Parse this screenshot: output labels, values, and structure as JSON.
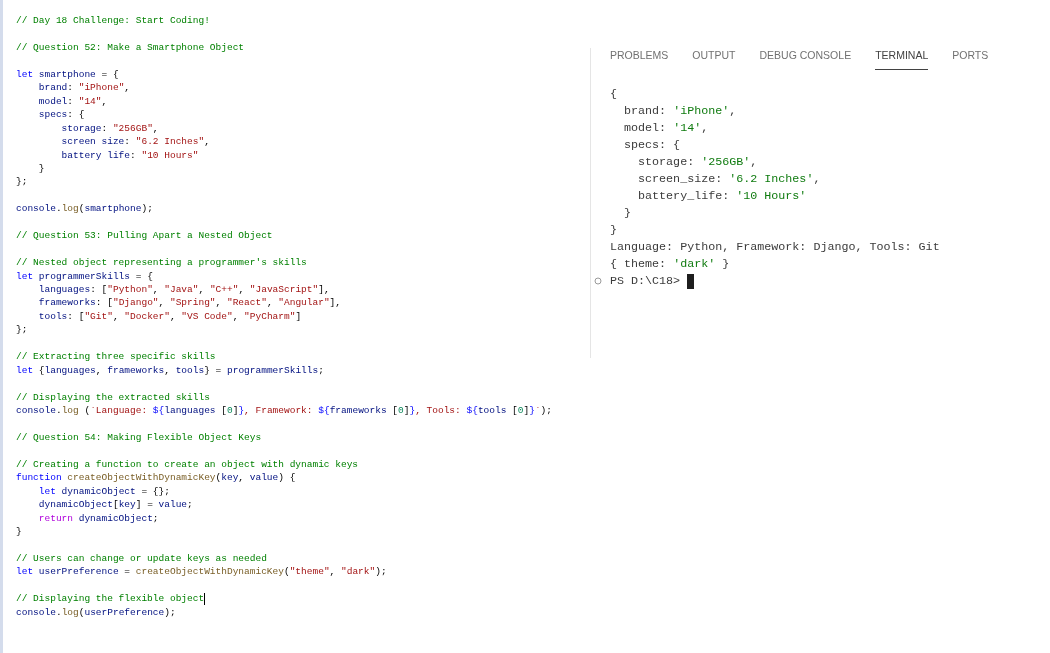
{
  "editor": {
    "blocks": [
      {
        "lines": [
          {
            "tokens": [
              {
                "kind": "comment",
                "text": "// Day 18 Challenge: Start Coding!"
              }
            ]
          }
        ]
      },
      {
        "lines": [
          {
            "tokens": [
              {
                "kind": "comment",
                "text": "// Question 52: Make a Smartphone Object"
              }
            ]
          }
        ]
      },
      {
        "lines": [
          {
            "tokens": [
              {
                "kind": "keyword",
                "text": "let"
              },
              {
                "kind": "variable",
                "text": " smartphone"
              },
              {
                "kind": "punct",
                "text": " = {"
              }
            ]
          },
          {
            "tokens": [
              {
                "kind": "variable",
                "text": "    brand"
              },
              {
                "kind": "punct",
                "text": ": "
              },
              {
                "kind": "string",
                "text": "\"iPhone\""
              },
              {
                "kind": "punct",
                "text": ","
              }
            ]
          },
          {
            "tokens": [
              {
                "kind": "variable",
                "text": "    model"
              },
              {
                "kind": "punct",
                "text": ": "
              },
              {
                "kind": "string",
                "text": "\"14\""
              },
              {
                "kind": "punct",
                "text": ","
              }
            ]
          },
          {
            "tokens": [
              {
                "kind": "variable",
                "text": "    specs"
              },
              {
                "kind": "punct",
                "text": ": {"
              }
            ]
          },
          {
            "tokens": [
              {
                "kind": "variable",
                "text": "        storage"
              },
              {
                "kind": "punct",
                "text": ": "
              },
              {
                "kind": "string",
                "text": "\"256GB\""
              },
              {
                "kind": "punct",
                "text": ","
              }
            ]
          },
          {
            "tokens": [
              {
                "kind": "variable",
                "text": "        screen size"
              },
              {
                "kind": "punct",
                "text": ": "
              },
              {
                "kind": "string",
                "text": "\"6.2 Inches\""
              },
              {
                "kind": "punct",
                "text": ","
              }
            ]
          },
          {
            "tokens": [
              {
                "kind": "variable",
                "text": "        battery life"
              },
              {
                "kind": "punct",
                "text": ": "
              },
              {
                "kind": "string",
                "text": "\"10 Hours\""
              }
            ]
          },
          {
            "tokens": [
              {
                "kind": "punct",
                "text": "    }"
              }
            ]
          },
          {
            "tokens": [
              {
                "kind": "punct",
                "text": "};"
              }
            ]
          }
        ]
      },
      {
        "lines": [
          {
            "tokens": [
              {
                "kind": "variable",
                "text": "console"
              },
              {
                "kind": "punct",
                "text": "."
              },
              {
                "kind": "function",
                "text": "log"
              },
              {
                "kind": "punct",
                "text": "("
              },
              {
                "kind": "variable",
                "text": "smartphone"
              },
              {
                "kind": "punct",
                "text": ");"
              }
            ]
          }
        ]
      },
      {
        "lines": [
          {
            "tokens": [
              {
                "kind": "comment",
                "text": "// Question 53: Pulling Apart a Nested Object"
              }
            ]
          }
        ]
      },
      {
        "lines": [
          {
            "tokens": [
              {
                "kind": "comment",
                "text": "// Nested object representing a programmer's skills"
              }
            ]
          },
          {
            "tokens": [
              {
                "kind": "keyword",
                "text": "let"
              },
              {
                "kind": "variable",
                "text": " programmerSkills"
              },
              {
                "kind": "punct",
                "text": " = {"
              }
            ]
          },
          {
            "tokens": [
              {
                "kind": "variable",
                "text": "    languages"
              },
              {
                "kind": "punct",
                "text": ": ["
              },
              {
                "kind": "string",
                "text": "\"Python\""
              },
              {
                "kind": "punct",
                "text": ", "
              },
              {
                "kind": "string",
                "text": "\"Java\""
              },
              {
                "kind": "punct",
                "text": ", "
              },
              {
                "kind": "string",
                "text": "\"C++\""
              },
              {
                "kind": "punct",
                "text": ", "
              },
              {
                "kind": "string",
                "text": "\"JavaScript\""
              },
              {
                "kind": "punct",
                "text": "],"
              }
            ]
          },
          {
            "tokens": [
              {
                "kind": "variable",
                "text": "    frameworks"
              },
              {
                "kind": "punct",
                "text": ": ["
              },
              {
                "kind": "string",
                "text": "\"Django\""
              },
              {
                "kind": "punct",
                "text": ", "
              },
              {
                "kind": "string",
                "text": "\"Spring\""
              },
              {
                "kind": "punct",
                "text": ", "
              },
              {
                "kind": "string",
                "text": "\"React\""
              },
              {
                "kind": "punct",
                "text": ", "
              },
              {
                "kind": "string",
                "text": "\"Angular\""
              },
              {
                "kind": "punct",
                "text": "],"
              }
            ]
          },
          {
            "tokens": [
              {
                "kind": "variable",
                "text": "    tools"
              },
              {
                "kind": "punct",
                "text": ": ["
              },
              {
                "kind": "string",
                "text": "\"Git\""
              },
              {
                "kind": "punct",
                "text": ", "
              },
              {
                "kind": "string",
                "text": "\"Docker\""
              },
              {
                "kind": "punct",
                "text": ", "
              },
              {
                "kind": "string",
                "text": "\"VS Code\""
              },
              {
                "kind": "punct",
                "text": ", "
              },
              {
                "kind": "string",
                "text": "\"PyCharm\""
              },
              {
                "kind": "punct",
                "text": "]"
              }
            ]
          },
          {
            "tokens": [
              {
                "kind": "punct",
                "text": "};"
              }
            ]
          }
        ]
      },
      {
        "lines": [
          {
            "tokens": [
              {
                "kind": "comment",
                "text": "// Extracting three specific skills"
              }
            ]
          },
          {
            "tokens": [
              {
                "kind": "keyword",
                "text": "let"
              },
              {
                "kind": "punct",
                "text": " {"
              },
              {
                "kind": "variable",
                "text": "languages"
              },
              {
                "kind": "punct",
                "text": ", "
              },
              {
                "kind": "variable",
                "text": "frameworks"
              },
              {
                "kind": "punct",
                "text": ", "
              },
              {
                "kind": "variable",
                "text": "tools"
              },
              {
                "kind": "punct",
                "text": "} = "
              },
              {
                "kind": "variable",
                "text": "programmerSkills"
              },
              {
                "kind": "punct",
                "text": ";"
              }
            ]
          }
        ]
      },
      {
        "lines": [
          {
            "tokens": [
              {
                "kind": "comment",
                "text": "// Displaying the extracted skills"
              }
            ]
          },
          {
            "tokens": [
              {
                "kind": "variable",
                "text": "console"
              },
              {
                "kind": "punct",
                "text": "."
              },
              {
                "kind": "function",
                "text": "log"
              },
              {
                "kind": "punct",
                "text": " ("
              },
              {
                "kind": "string",
                "text": "`Language: "
              },
              {
                "kind": "keyword",
                "text": "${"
              },
              {
                "kind": "variable",
                "text": "languages"
              },
              {
                "kind": "punct",
                "text": " ["
              },
              {
                "kind": "number",
                "text": "0"
              },
              {
                "kind": "punct",
                "text": "]"
              },
              {
                "kind": "keyword",
                "text": "}"
              },
              {
                "kind": "string",
                "text": ", Framework: "
              },
              {
                "kind": "keyword",
                "text": "${"
              },
              {
                "kind": "variable",
                "text": "frameworks"
              },
              {
                "kind": "punct",
                "text": " ["
              },
              {
                "kind": "number",
                "text": "0"
              },
              {
                "kind": "punct",
                "text": "]"
              },
              {
                "kind": "keyword",
                "text": "}"
              },
              {
                "kind": "string",
                "text": ", Tools: "
              },
              {
                "kind": "keyword",
                "text": "${"
              },
              {
                "kind": "variable",
                "text": "tools"
              },
              {
                "kind": "punct",
                "text": " ["
              },
              {
                "kind": "number",
                "text": "0"
              },
              {
                "kind": "punct",
                "text": "]"
              },
              {
                "kind": "keyword",
                "text": "}"
              },
              {
                "kind": "string",
                "text": "`"
              },
              {
                "kind": "punct",
                "text": ");"
              }
            ]
          }
        ]
      },
      {
        "lines": [
          {
            "tokens": [
              {
                "kind": "comment",
                "text": "// Question 54: Making Flexible Object Keys"
              }
            ]
          }
        ]
      },
      {
        "lines": [
          {
            "tokens": [
              {
                "kind": "comment",
                "text": "// Creating a function to create an object with dynamic keys"
              }
            ]
          },
          {
            "tokens": [
              {
                "kind": "keyword",
                "text": "function"
              },
              {
                "kind": "function",
                "text": " createObjectWithDynamicKey"
              },
              {
                "kind": "punct",
                "text": "("
              },
              {
                "kind": "variable",
                "text": "key"
              },
              {
                "kind": "punct",
                "text": ", "
              },
              {
                "kind": "variable",
                "text": "value"
              },
              {
                "kind": "punct",
                "text": ") {"
              }
            ]
          },
          {
            "tokens": [
              {
                "kind": "keyword",
                "text": "    let"
              },
              {
                "kind": "variable",
                "text": " dynamicObject"
              },
              {
                "kind": "punct",
                "text": " = {};"
              }
            ]
          },
          {
            "tokens": [
              {
                "kind": "variable",
                "text": "    dynamicObject"
              },
              {
                "kind": "punct",
                "text": "["
              },
              {
                "kind": "variable",
                "text": "key"
              },
              {
                "kind": "punct",
                "text": "] = "
              },
              {
                "kind": "variable",
                "text": "value"
              },
              {
                "kind": "punct",
                "text": ";"
              }
            ]
          },
          {
            "tokens": [
              {
                "kind": "control",
                "text": "    return"
              },
              {
                "kind": "variable",
                "text": " dynamicObject"
              },
              {
                "kind": "punct",
                "text": ";"
              }
            ]
          },
          {
            "tokens": [
              {
                "kind": "punct",
                "text": "}"
              }
            ]
          }
        ]
      },
      {
        "lines": [
          {
            "tokens": [
              {
                "kind": "comment",
                "text": "// Users can change or update keys as needed"
              }
            ]
          },
          {
            "tokens": [
              {
                "kind": "keyword",
                "text": "let"
              },
              {
                "kind": "variable",
                "text": " userPreference"
              },
              {
                "kind": "punct",
                "text": " = "
              },
              {
                "kind": "function",
                "text": "createObjectWithDynamicKey"
              },
              {
                "kind": "punct",
                "text": "("
              },
              {
                "kind": "string",
                "text": "\"theme\""
              },
              {
                "kind": "punct",
                "text": ", "
              },
              {
                "kind": "string",
                "text": "\"dark\""
              },
              {
                "kind": "punct",
                "text": ");"
              }
            ]
          }
        ]
      },
      {
        "lines": [
          {
            "tokens": [
              {
                "kind": "comment",
                "text": "// Displaying the flexible object"
              },
              {
                "kind": "caret"
              }
            ]
          },
          {
            "tokens": [
              {
                "kind": "variable",
                "text": "console"
              },
              {
                "kind": "punct",
                "text": "."
              },
              {
                "kind": "function",
                "text": "log"
              },
              {
                "kind": "punct",
                "text": "("
              },
              {
                "kind": "variable",
                "text": "userPreference"
              },
              {
                "kind": "punct",
                "text": ");"
              }
            ]
          }
        ]
      }
    ]
  },
  "panel": {
    "tabs": [
      {
        "label": "PROBLEMS",
        "selected": false
      },
      {
        "label": "OUTPUT",
        "selected": false
      },
      {
        "label": "DEBUG CONSOLE",
        "selected": false
      },
      {
        "label": "TERMINAL",
        "selected": true
      },
      {
        "label": "PORTS",
        "selected": false
      }
    ],
    "terminal": {
      "lines": [
        {
          "tokens": [
            {
              "kind": "punct",
              "text": "{"
            }
          ]
        },
        {
          "tokens": [
            {
              "kind": "punct",
              "text": "  brand: "
            },
            {
              "kind": "string",
              "text": "'iPhone'"
            },
            {
              "kind": "punct",
              "text": ","
            }
          ]
        },
        {
          "tokens": [
            {
              "kind": "punct",
              "text": "  model: "
            },
            {
              "kind": "string",
              "text": "'14'"
            },
            {
              "kind": "punct",
              "text": ","
            }
          ]
        },
        {
          "tokens": [
            {
              "kind": "punct",
              "text": "  specs: {"
            }
          ]
        },
        {
          "tokens": [
            {
              "kind": "punct",
              "text": "    storage: "
            },
            {
              "kind": "string",
              "text": "'256GB'"
            },
            {
              "kind": "punct",
              "text": ","
            }
          ]
        },
        {
          "tokens": [
            {
              "kind": "punct",
              "text": "    screen_size: "
            },
            {
              "kind": "string",
              "text": "'6.2 Inches'"
            },
            {
              "kind": "punct",
              "text": ","
            }
          ]
        },
        {
          "tokens": [
            {
              "kind": "punct",
              "text": "    battery_life: "
            },
            {
              "kind": "string",
              "text": "'10 Hours'"
            }
          ]
        },
        {
          "tokens": [
            {
              "kind": "punct",
              "text": "  }"
            }
          ]
        },
        {
          "tokens": [
            {
              "kind": "punct",
              "text": "}"
            }
          ]
        },
        {
          "tokens": [
            {
              "kind": "punct",
              "text": "Language: Python, Framework: Django, Tools: Git"
            }
          ]
        },
        {
          "tokens": [
            {
              "kind": "punct",
              "text": "{ theme: "
            },
            {
              "kind": "string",
              "text": "'dark'"
            },
            {
              "kind": "punct",
              "text": " }"
            }
          ]
        }
      ],
      "prompt": "PS D:\\C18>"
    }
  }
}
